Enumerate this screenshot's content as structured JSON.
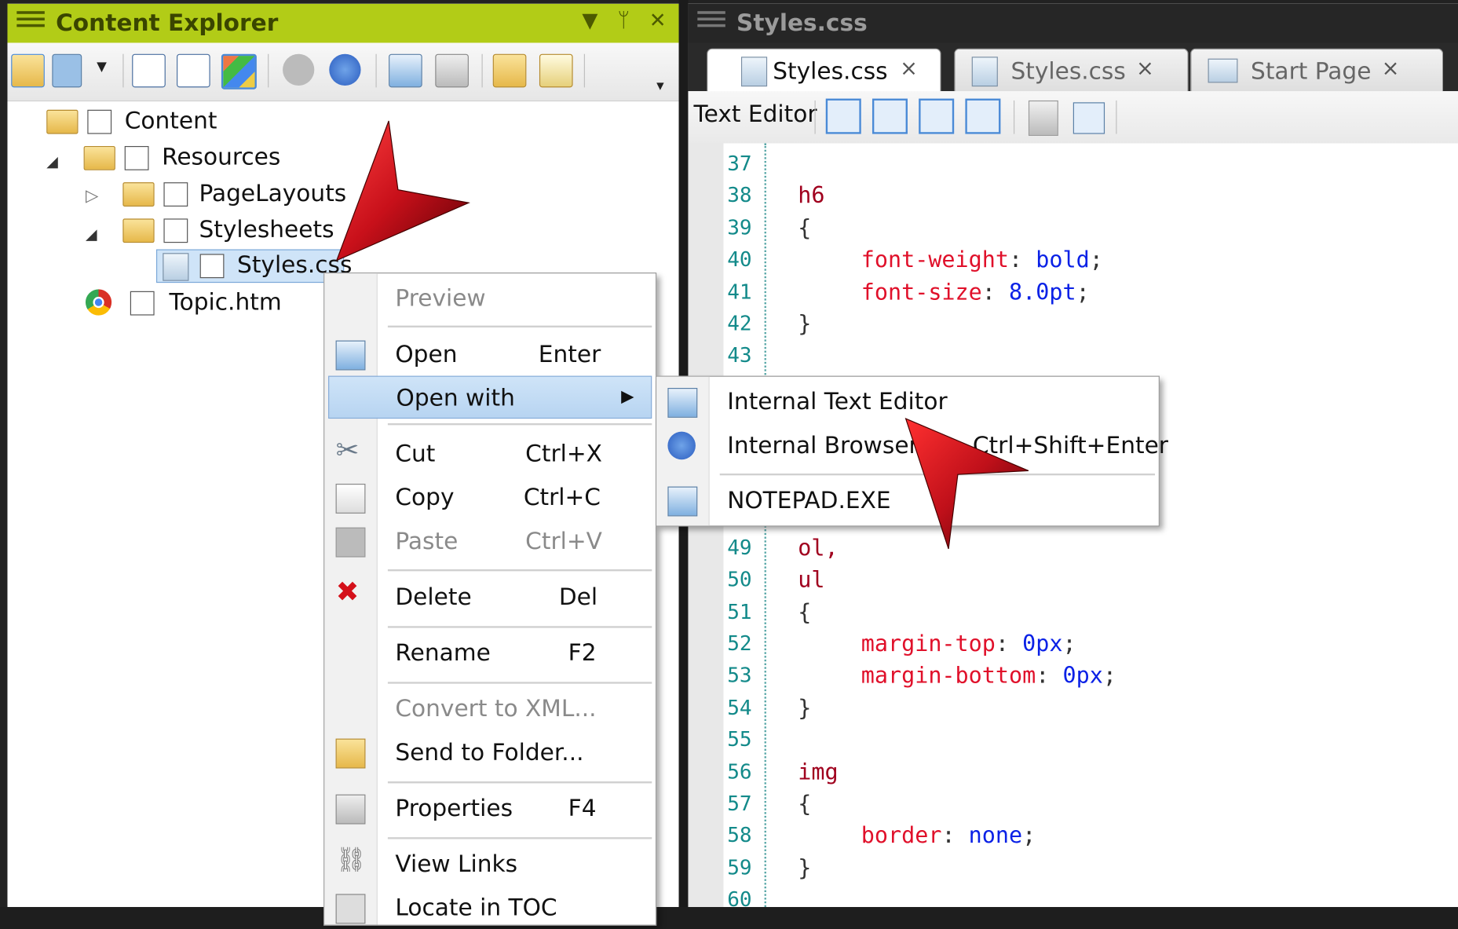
{
  "left_panel": {
    "title": "Content Explorer",
    "tree": [
      {
        "label": "Content"
      },
      {
        "label": "Resources"
      },
      {
        "label": "PageLayouts"
      },
      {
        "label": "Stylesheets"
      },
      {
        "label": "Styles.css"
      },
      {
        "label": "Topic.htm"
      }
    ]
  },
  "right_panel": {
    "title": "Styles.css",
    "tabs": [
      {
        "label": "Styles.css",
        "close": "×"
      },
      {
        "label": "Styles.css",
        "close": "×"
      },
      {
        "label": "Start Page",
        "close": "×"
      }
    ],
    "editor_toolbar_label": "Text Editor",
    "code_lines": [
      {
        "n": "37",
        "text": ""
      },
      {
        "n": "38",
        "text": "h6"
      },
      {
        "n": "39",
        "text": "{"
      },
      {
        "n": "40",
        "prop": "font-weight",
        "value": "bold"
      },
      {
        "n": "41",
        "prop": "font-size",
        "value": "8.0pt"
      },
      {
        "n": "42",
        "text": "}"
      },
      {
        "n": "43",
        "text": ""
      },
      {
        "n": "49",
        "text": "ol,"
      },
      {
        "n": "50",
        "text": "ul"
      },
      {
        "n": "51",
        "text": "{"
      },
      {
        "n": "52",
        "prop": "margin-top",
        "value": "0px"
      },
      {
        "n": "53",
        "prop": "margin-bottom",
        "value": "0px"
      },
      {
        "n": "54",
        "text": "}"
      },
      {
        "n": "55",
        "text": ""
      },
      {
        "n": "56",
        "text": "img"
      },
      {
        "n": "57",
        "text": "{"
      },
      {
        "n": "58",
        "prop": "border",
        "value": "none"
      },
      {
        "n": "59",
        "text": "}"
      },
      {
        "n": "60",
        "text": ""
      }
    ]
  },
  "context_menu": {
    "items": [
      {
        "label": "Preview",
        "shortcut": ""
      },
      {
        "label": "Open",
        "shortcut": "Enter"
      },
      {
        "label": "Open with",
        "shortcut": ""
      },
      {
        "label": "Cut",
        "shortcut": "Ctrl+X"
      },
      {
        "label": "Copy",
        "shortcut": "Ctrl+C"
      },
      {
        "label": "Paste",
        "shortcut": "Ctrl+V"
      },
      {
        "label": "Delete",
        "shortcut": "Del"
      },
      {
        "label": "Rename",
        "shortcut": "F2"
      },
      {
        "label": "Convert to XML...",
        "shortcut": ""
      },
      {
        "label": "Send to Folder...",
        "shortcut": ""
      },
      {
        "label": "Properties",
        "shortcut": "F4"
      },
      {
        "label": "View Links",
        "shortcut": ""
      },
      {
        "label": "Locate in TOC",
        "shortcut": ""
      }
    ]
  },
  "submenu": {
    "items": [
      {
        "label": "Internal Text Editor",
        "shortcut": ""
      },
      {
        "label": "Internal Browser",
        "shortcut": "Ctrl+Shift+Enter"
      },
      {
        "label": "NOTEPAD.EXE",
        "shortcut": ""
      }
    ]
  },
  "colors": {
    "panel_header": "#b2cc17",
    "highlight": "#cfe4f8",
    "pointer": "#c8101a"
  }
}
